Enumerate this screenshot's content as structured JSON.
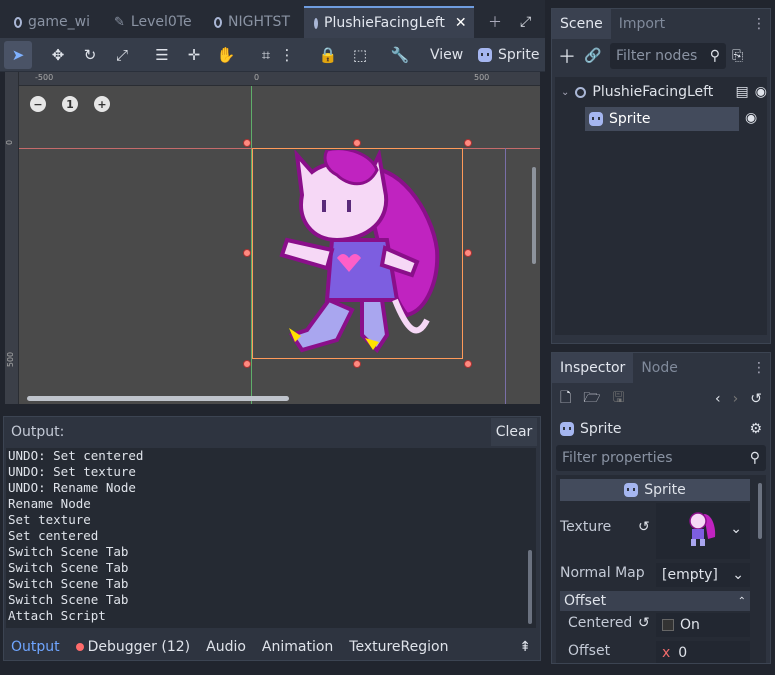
{
  "scene_tabs": [
    {
      "label": "game_wi"
    },
    {
      "label": "Level0Te"
    },
    {
      "label": "NIGHTST"
    },
    {
      "label": "PlushieFacingLeft",
      "active": true
    }
  ],
  "toolbar": {
    "view_label": "View",
    "sprite_label": "Sprite"
  },
  "ruler": {
    "h_ticks": [
      "-500",
      "0",
      "500"
    ],
    "v_ticks": [
      "0",
      "500"
    ]
  },
  "zoom": {
    "minus": "−",
    "reset": "1",
    "plus": "+"
  },
  "output": {
    "title": "Output:",
    "clear_label": "Clear",
    "lines": [
      "UNDO: Set centered",
      "UNDO: Set texture",
      "UNDO: Rename Node",
      "Rename Node",
      "Set texture",
      "Set centered",
      "Switch Scene Tab",
      "Switch Scene Tab",
      "Switch Scene Tab",
      "Switch Scene Tab",
      "Attach Script"
    ]
  },
  "bottom_tabs": [
    {
      "label": "Output",
      "active": true
    },
    {
      "label": "Debugger (12)"
    },
    {
      "label": "Audio"
    },
    {
      "label": "Animation"
    },
    {
      "label": "TextureRegion"
    }
  ],
  "scene_dock": {
    "tabs": [
      "Scene",
      "Import"
    ],
    "filter_placeholder": "Filter nodes",
    "tree": [
      {
        "label": "PlushieFacingLeft"
      },
      {
        "label": "Sprite"
      }
    ]
  },
  "inspector": {
    "tabs": [
      "Inspector",
      "Node"
    ],
    "object_label": "Sprite",
    "filter_placeholder": "Filter properties",
    "section_label": "Sprite",
    "texture_label": "Texture",
    "normal_map_label": "Normal Map",
    "normal_map_value": "[empty]",
    "offset_section": "Offset",
    "centered_label": "Centered",
    "centered_value": "On",
    "offset_label": "Offset",
    "offset_x_label": "x",
    "offset_x_value": "0"
  },
  "colors": {
    "accent": "#6fa5ff",
    "sprite_icon": "#a5b6f0",
    "debugger_dot": "#ff6b6b"
  }
}
